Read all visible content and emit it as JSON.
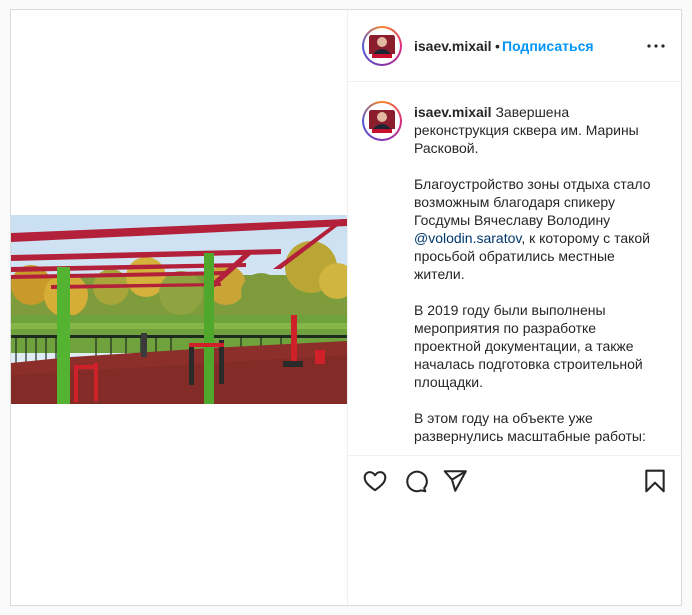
{
  "header": {
    "username": "isaev.mixail",
    "separator": "•",
    "follow_label": "Подписаться"
  },
  "caption": {
    "username": "isaev.mixail",
    "paragraph1": "Завершена реконструкция сквера им. Марины Расковой.",
    "paragraph2_before": "Благоустройство зоны отдыха стало возможным благодаря спикеру Госдумы Вячеславу Володину ",
    "mention": "@volodin.saratov",
    "paragraph2_after": ", к которому с такой просьбой обратились местные жители.",
    "paragraph3": "В 2019 году были выполнены мероприятия по разработке проектной документации, а также началась подготовка строительной площадки.",
    "paragraph4": "В этом году на объекте уже развернулись масштабные работы:"
  },
  "icons": {
    "more": "more-options-icon",
    "like": "heart-icon",
    "comment": "comment-icon",
    "share": "paper-plane-icon",
    "save": "bookmark-icon"
  },
  "colors": {
    "follow": "#0095f6",
    "text": "#262626",
    "border": "#dbdbdb",
    "mention": "#00376b"
  }
}
